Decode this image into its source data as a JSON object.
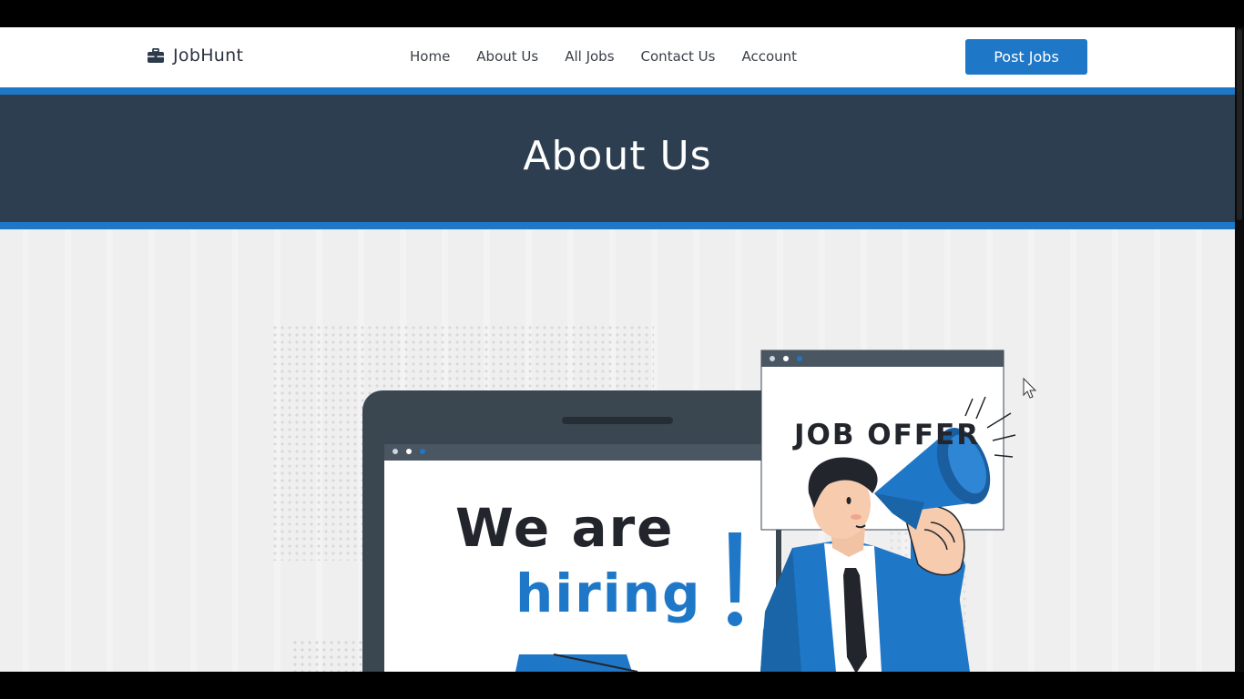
{
  "navbar": {
    "brand_icon": "briefcase-icon",
    "brand_name": "JobHunt",
    "links": [
      "Home",
      "About Us",
      "All Jobs",
      "Contact Us",
      "Account"
    ],
    "post_button": "Post Jobs"
  },
  "banner": {
    "title": "About Us"
  },
  "illustration": {
    "line1": "We are",
    "line2": "hiring",
    "exclamation": "!",
    "sign_text": "JOB OFFER"
  },
  "colors": {
    "accent": "#1f77c8",
    "banner_bg": "#2c3e50",
    "page_bg": "#efefef"
  }
}
